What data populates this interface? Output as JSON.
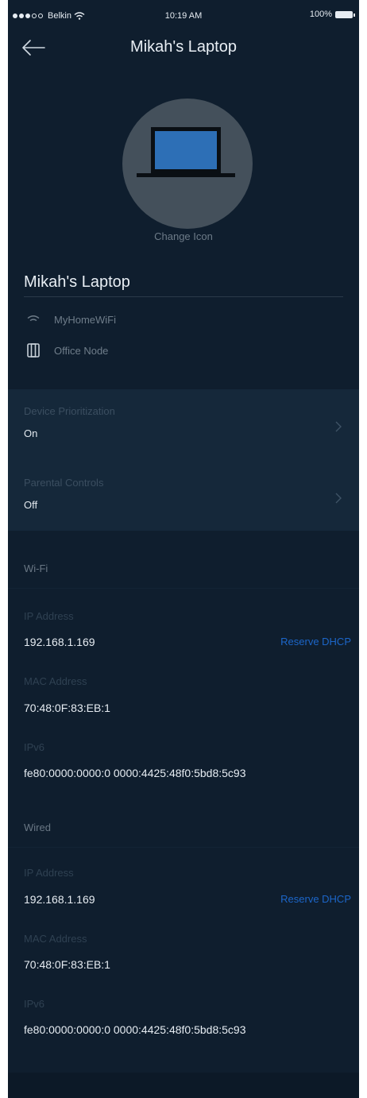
{
  "status_bar": {
    "carrier": "Belkin",
    "time": "10:19 AM",
    "battery": "100%"
  },
  "header": {
    "title": "Mikah's Laptop"
  },
  "avatar": {
    "change_label": "Change Icon",
    "icon": "laptop-icon"
  },
  "device": {
    "name": "Mikah's Laptop",
    "network": "MyHomeWiFi",
    "node": "Office Node"
  },
  "settings": [
    {
      "label": "Device Prioritization",
      "value": "On"
    },
    {
      "label": "Parental Controls",
      "value": "Off"
    }
  ],
  "wifi": {
    "section_label": "Wi-Fi",
    "ip_label": "IP Address",
    "ip": "192.168.1.169",
    "reserve_label": "Reserve DHCP",
    "mac_label": "MAC Address",
    "mac": "70:48:0F:83:EB:1",
    "ipv6_label": "IPv6",
    "ipv6": "fe80:0000:0000:0 0000:4425:48f0:5bd8:5c93"
  },
  "wired": {
    "section_label": "Wired",
    "ip_label": "IP Address",
    "ip": "192.168.1.169",
    "reserve_label": "Reserve DHCP",
    "mac_label": "MAC Address",
    "mac": "70:48:0F:83:EB:1",
    "ipv6_label": "IPv6",
    "ipv6": "fe80:0000:0000:0 0000:4425:48f0:5bd8:5c93"
  },
  "colors": {
    "background": "#0f1e2e",
    "panel": "#15283a",
    "accent": "#1c66c9"
  }
}
